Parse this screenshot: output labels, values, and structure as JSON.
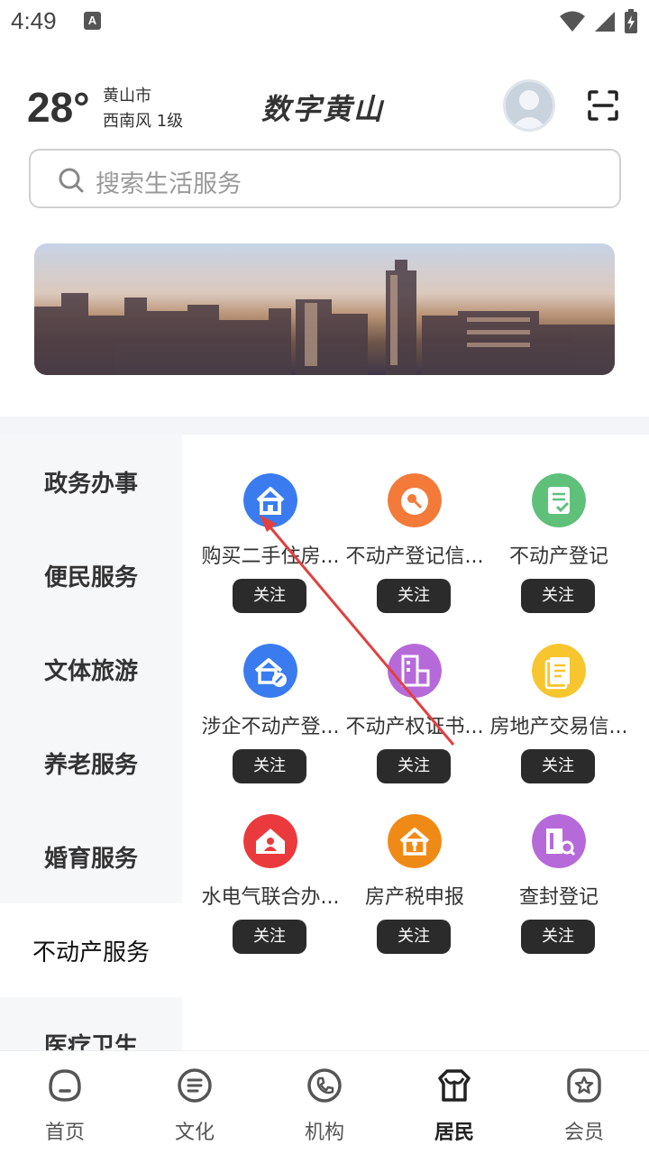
{
  "status_bar": {
    "time": "4:49",
    "notification_badge": "A"
  },
  "header": {
    "temperature": "28°",
    "city": "黄山市",
    "wind": "西南风  1级",
    "title": "数字黄山"
  },
  "search": {
    "placeholder": "搜索生活服务"
  },
  "categories": [
    {
      "label": "政务办事"
    },
    {
      "label": "便民服务"
    },
    {
      "label": "文体旅游"
    },
    {
      "label": "养老服务"
    },
    {
      "label": "婚育服务"
    },
    {
      "label": "不动产服务",
      "active": true
    },
    {
      "label": "医疗卫生"
    }
  ],
  "services": [
    {
      "label": "购买二手住房...",
      "follow": "关注",
      "icon": "house-icon",
      "color": "#3a7cf0"
    },
    {
      "label": "不动产登记信...",
      "follow": "关注",
      "icon": "key-icon",
      "color": "#f47a3a"
    },
    {
      "label": "不动产登记",
      "follow": "关注",
      "icon": "document-check-icon",
      "color": "#5fc07a"
    },
    {
      "label": "涉企不动产登...",
      "follow": "关注",
      "icon": "enterprise-icon",
      "color": "#3a7cf0"
    },
    {
      "label": "不动产权证书...",
      "follow": "关注",
      "icon": "certificate-icon",
      "color": "#b66ad9"
    },
    {
      "label": "房地产交易信...",
      "follow": "关注",
      "icon": "document-icon",
      "color": "#f7c52e"
    },
    {
      "label": "水电气联合办...",
      "follow": "关注",
      "icon": "home-person-icon",
      "color": "#ea3a3e"
    },
    {
      "label": "房产税申报",
      "follow": "关注",
      "icon": "house-key-icon",
      "color": "#f08a17"
    },
    {
      "label": "查封登记",
      "follow": "关注",
      "icon": "building-search-icon",
      "color": "#b66ad9"
    }
  ],
  "bottom_nav": [
    {
      "label": "首页",
      "icon": "home-face-icon"
    },
    {
      "label": "文化",
      "icon": "culture-icon"
    },
    {
      "label": "机构",
      "icon": "phone-icon"
    },
    {
      "label": "居民",
      "icon": "resident-icon",
      "active": true
    },
    {
      "label": "会员",
      "icon": "member-icon"
    }
  ]
}
